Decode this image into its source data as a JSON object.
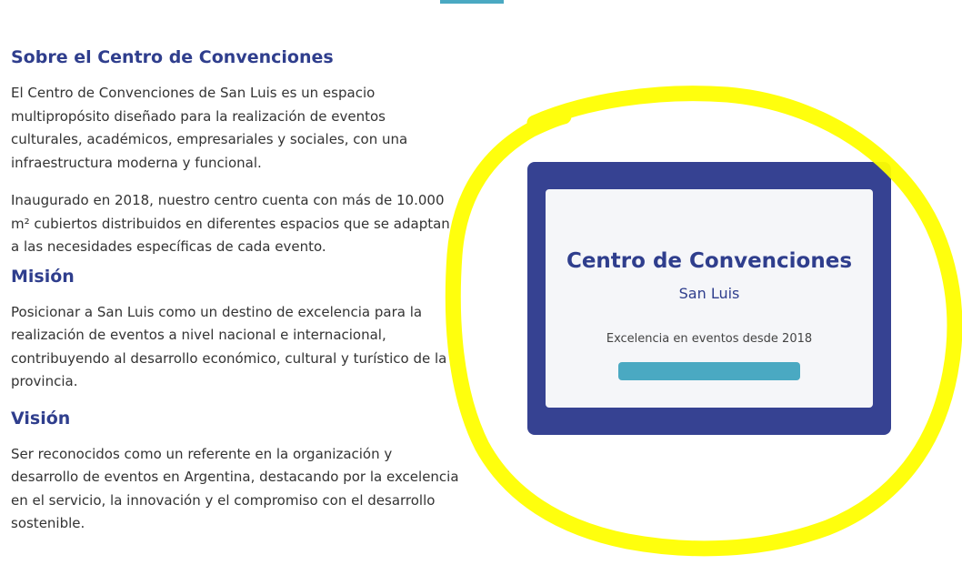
{
  "about": {
    "heading": "Sobre el Centro de Convenciones",
    "paragraph_1": "El Centro de Convenciones de San Luis es un espacio multipropósito diseñado para la realización de eventos culturales, académicos, empresariales y sociales, con una infraestructura moderna y funcional.",
    "paragraph_2": "Inaugurado en 2018, nuestro centro cuenta con más de 10.000 m² cubiertos distribuidos en diferentes espacios que se adaptan a las necesidades específicas de cada evento."
  },
  "mission": {
    "heading": "Misión",
    "text": "Posicionar a San Luis como un destino de excelencia para la realización de eventos a nivel nacional e internacional, contribuyendo al desarrollo económico, cultural y turístico de la provincia."
  },
  "vision": {
    "heading": "Visión",
    "text": "Ser reconocidos como un referente en la organización y desarrollo de eventos en Argentina, destacando por la excelencia en el servicio, la innovación y el compromiso con el desarrollo sostenible."
  },
  "card": {
    "title": "Centro de Convenciones",
    "subtitle": "San Luis",
    "tagline": "Excelencia en eventos desde 2018"
  },
  "colors": {
    "primary": "#364292",
    "heading": "#2f3e8d",
    "accent": "#4aa9c2",
    "highlight": "#ffff00"
  }
}
